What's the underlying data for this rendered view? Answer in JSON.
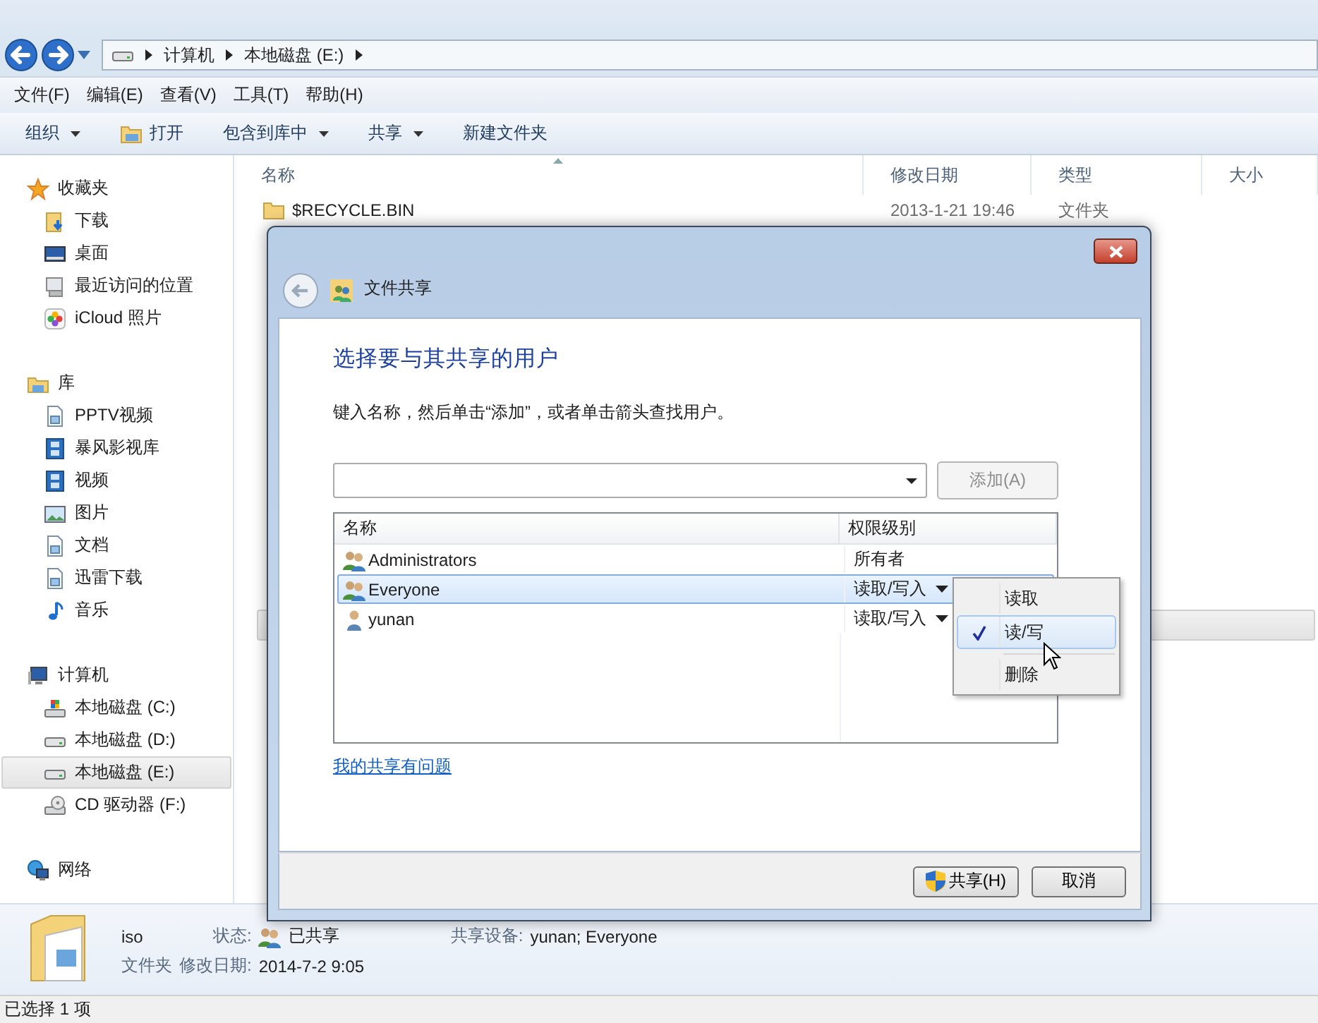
{
  "window": {
    "address_path": [
      "计算机",
      "本地磁盘 (E:)"
    ]
  },
  "menu_bar": [
    "文件(F)",
    "编辑(E)",
    "查看(V)",
    "工具(T)",
    "帮助(H)"
  ],
  "toolbar": [
    {
      "label": "组织",
      "kind": "dropdown"
    },
    {
      "label": "打开",
      "kind": "open"
    },
    {
      "label": "包含到库中",
      "kind": "dropdown"
    },
    {
      "label": "共享",
      "kind": "dropdown"
    },
    {
      "label": "新建文件夹",
      "kind": "plain"
    }
  ],
  "sidebar": [
    {
      "label": "收藏夹",
      "kind": "star",
      "children": [
        {
          "label": "下载",
          "kind": "download",
          "selected": false
        },
        {
          "label": "桌面",
          "kind": "desktop",
          "selected": false
        },
        {
          "label": "最近访问的位置",
          "kind": "recent",
          "selected": false
        },
        {
          "label": "iCloud 照片",
          "kind": "photos",
          "selected": false
        }
      ]
    },
    {
      "label": "库",
      "kind": "library",
      "children": [
        {
          "label": "PPTV视频",
          "kind": "doc",
          "selected": false
        },
        {
          "label": "暴风影视库",
          "kind": "film",
          "selected": false
        },
        {
          "label": "视频",
          "kind": "film",
          "selected": false
        },
        {
          "label": "图片",
          "kind": "image",
          "selected": false
        },
        {
          "label": "文档",
          "kind": "doc",
          "selected": false
        },
        {
          "label": "迅雷下载",
          "kind": "doc",
          "selected": false
        },
        {
          "label": "音乐",
          "kind": "music",
          "selected": false
        }
      ]
    },
    {
      "label": "计算机",
      "kind": "computer",
      "children": [
        {
          "label": "本地磁盘 (C:)",
          "kind": "sysdrive",
          "selected": false
        },
        {
          "label": "本地磁盘 (D:)",
          "kind": "drive",
          "selected": false
        },
        {
          "label": "本地磁盘 (E:)",
          "kind": "drive",
          "selected": true
        },
        {
          "label": "CD 驱动器 (F:)",
          "kind": "cd",
          "selected": false
        }
      ]
    },
    {
      "label": "网络",
      "kind": "network"
    }
  ],
  "file_list": {
    "columns": [
      "名称",
      "修改日期",
      "类型",
      "大小"
    ],
    "rows": [
      {
        "name": "$RECYCLE.BIN",
        "modified": "2013-1-21 19:46",
        "type": "文件夹",
        "selected": false
      },
      {
        "selected": true
      }
    ]
  },
  "details_pane": {
    "name": "iso",
    "type": "文件夹",
    "state_label": "状态:",
    "state": "已共享",
    "modified_label": "修改日期:",
    "modified": "2014-7-2 9:05",
    "shared_label": "共享设备:",
    "shared_with": "yunan; Everyone"
  },
  "status_bar": "已选择 1 项",
  "dialog": {
    "title": "文件共享",
    "heading": "选择要与其共享的用户",
    "instruction": "键入名称，然后单击“添加”，或者单击箭头查找用户。",
    "add_button": {
      "label": "添加(A)",
      "disabled": true
    },
    "columns": [
      "名称",
      "权限级别"
    ],
    "users": [
      {
        "name": "Administrators",
        "kind": "group",
        "permission": "所有者",
        "has_menu": false,
        "selected": false
      },
      {
        "name": "Everyone",
        "kind": "group",
        "permission": "读取/写入",
        "has_menu": true,
        "selected": true
      },
      {
        "name": "yunan",
        "kind": "user",
        "permission": "读取/写入",
        "has_menu": true,
        "selected": false
      }
    ],
    "permission_menu": [
      {
        "label": "读取",
        "checked": false,
        "selected": false,
        "separator_before": false
      },
      {
        "label": "读/写",
        "checked": true,
        "selected": true,
        "separator_before": false
      },
      {
        "label": "删除",
        "checked": false,
        "selected": false,
        "separator_before": true
      }
    ],
    "help_link": "我的共享有问题",
    "buttons": [
      {
        "label": "共享(H)",
        "kind": "shield"
      },
      {
        "label": "取消",
        "kind": "plain"
      }
    ]
  }
}
